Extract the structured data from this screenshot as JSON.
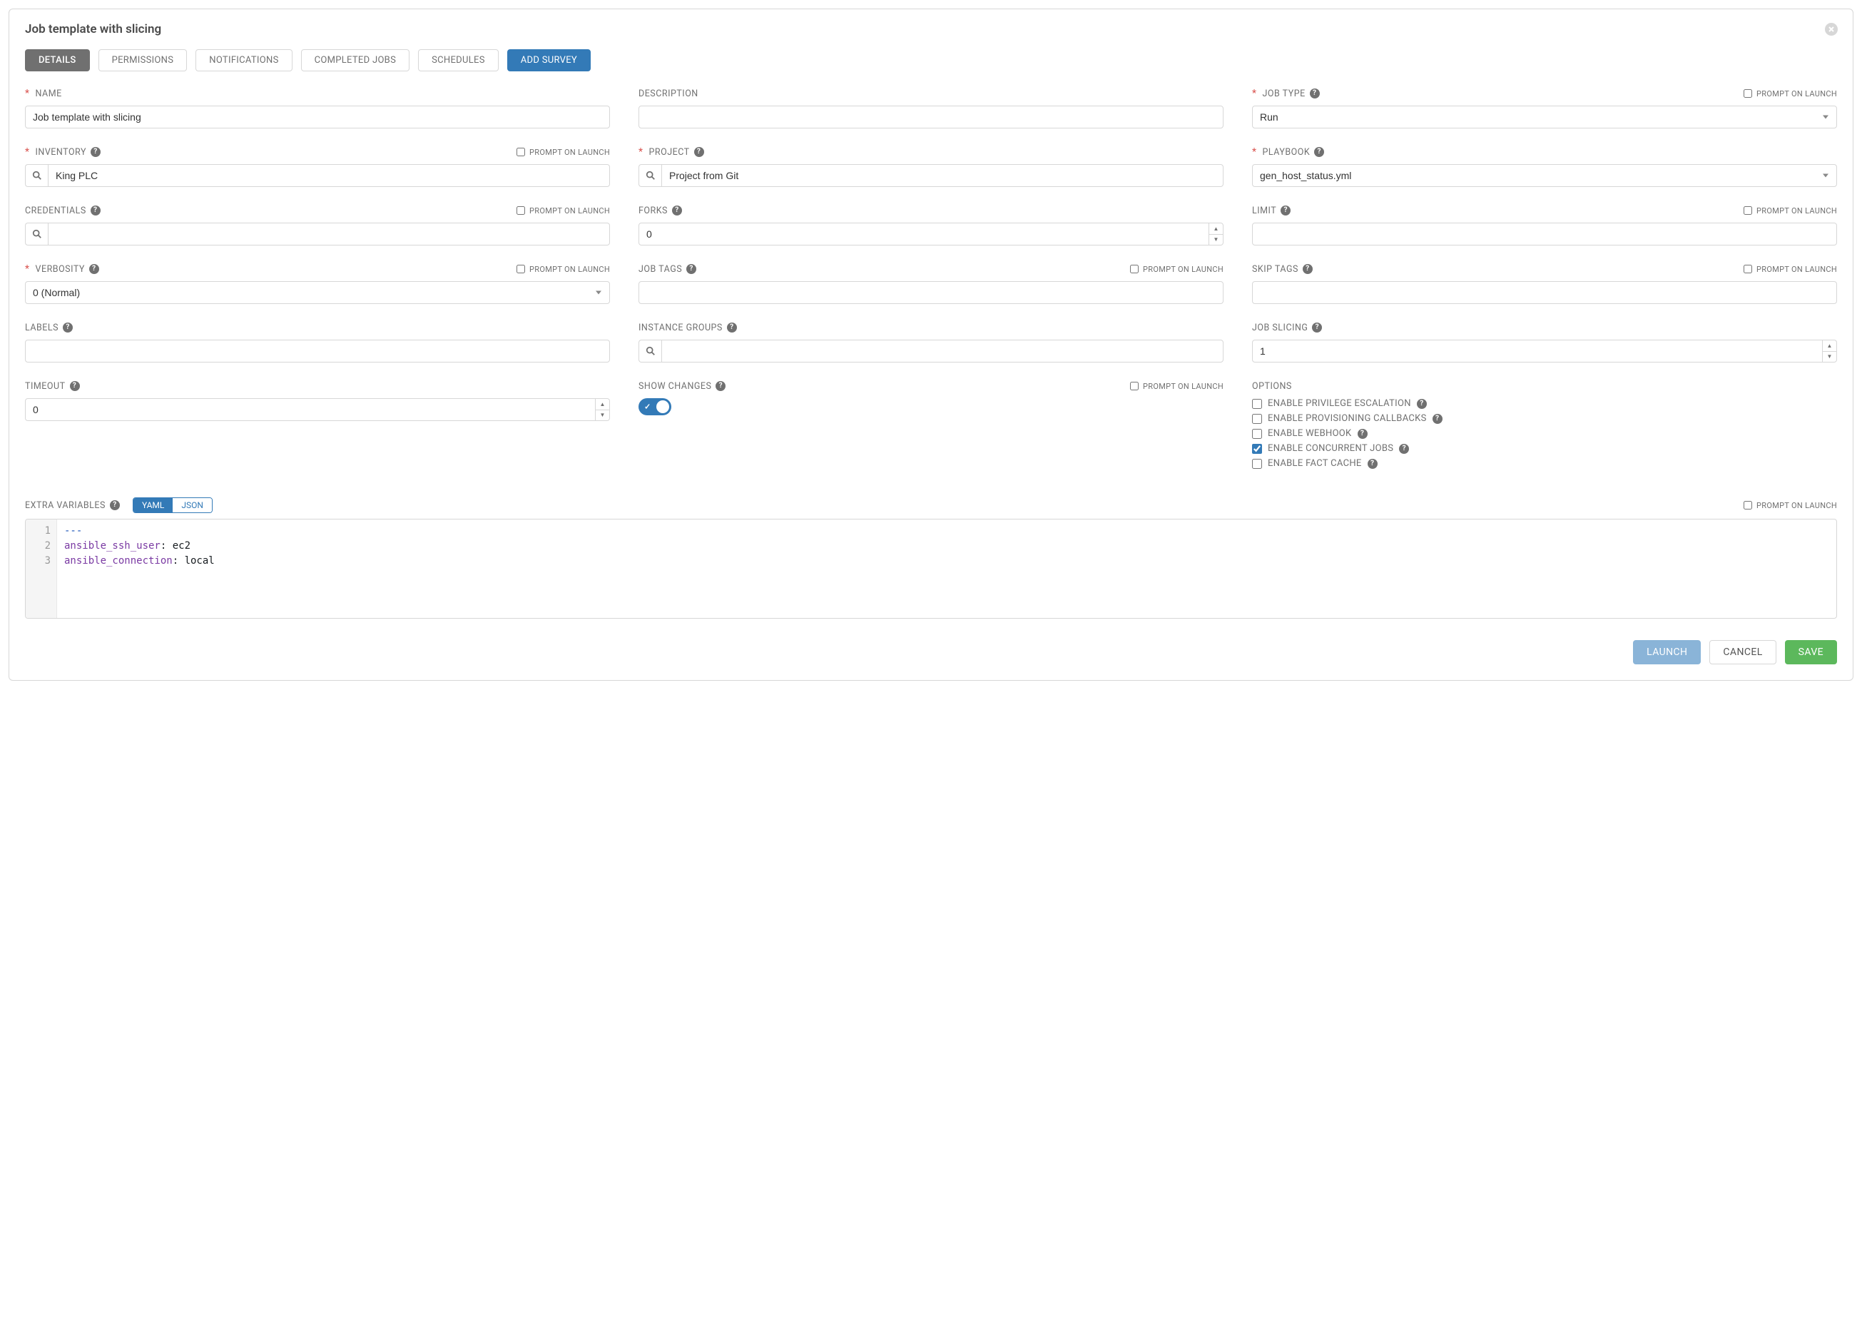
{
  "title": "Job template with slicing",
  "tabs": {
    "details": "DETAILS",
    "permissions": "PERMISSIONS",
    "notifications": "NOTIFICATIONS",
    "completed": "COMPLETED JOBS",
    "schedules": "SCHEDULES",
    "add_survey": "ADD SURVEY"
  },
  "prompt_label": "PROMPT ON LAUNCH",
  "fields": {
    "name": {
      "label": "NAME",
      "value": "Job template with slicing"
    },
    "description": {
      "label": "DESCRIPTION",
      "value": ""
    },
    "job_type": {
      "label": "JOB TYPE",
      "value": "Run"
    },
    "inventory": {
      "label": "INVENTORY",
      "value": "King PLC"
    },
    "project": {
      "label": "PROJECT",
      "value": "Project from Git"
    },
    "playbook": {
      "label": "PLAYBOOK",
      "value": "gen_host_status.yml"
    },
    "credentials": {
      "label": "CREDENTIALS",
      "value": ""
    },
    "forks": {
      "label": "FORKS",
      "value": "0"
    },
    "limit": {
      "label": "LIMIT",
      "value": ""
    },
    "verbosity": {
      "label": "VERBOSITY",
      "value": "0 (Normal)"
    },
    "job_tags": {
      "label": "JOB TAGS",
      "value": ""
    },
    "skip_tags": {
      "label": "SKIP TAGS",
      "value": ""
    },
    "labels": {
      "label": "LABELS",
      "value": ""
    },
    "instance_groups": {
      "label": "INSTANCE GROUPS",
      "value": ""
    },
    "job_slicing": {
      "label": "JOB SLICING",
      "value": "1"
    },
    "timeout": {
      "label": "TIMEOUT",
      "value": "0"
    },
    "show_changes": {
      "label": "SHOW CHANGES"
    },
    "options": {
      "label": "OPTIONS"
    }
  },
  "options": {
    "priv_esc": "ENABLE PRIVILEGE ESCALATION",
    "prov_cb": "ENABLE PROVISIONING CALLBACKS",
    "webhook": "ENABLE WEBHOOK",
    "concurrent": "ENABLE CONCURRENT JOBS",
    "fact_cache": "ENABLE FACT CACHE"
  },
  "extra_vars": {
    "label": "EXTRA VARIABLES",
    "mode_yaml": "YAML",
    "mode_json": "JSON",
    "lines": [
      "---",
      "ansible_ssh_user: ec2",
      "ansible_connection: local"
    ]
  },
  "buttons": {
    "launch": "LAUNCH",
    "cancel": "CANCEL",
    "save": "SAVE"
  }
}
